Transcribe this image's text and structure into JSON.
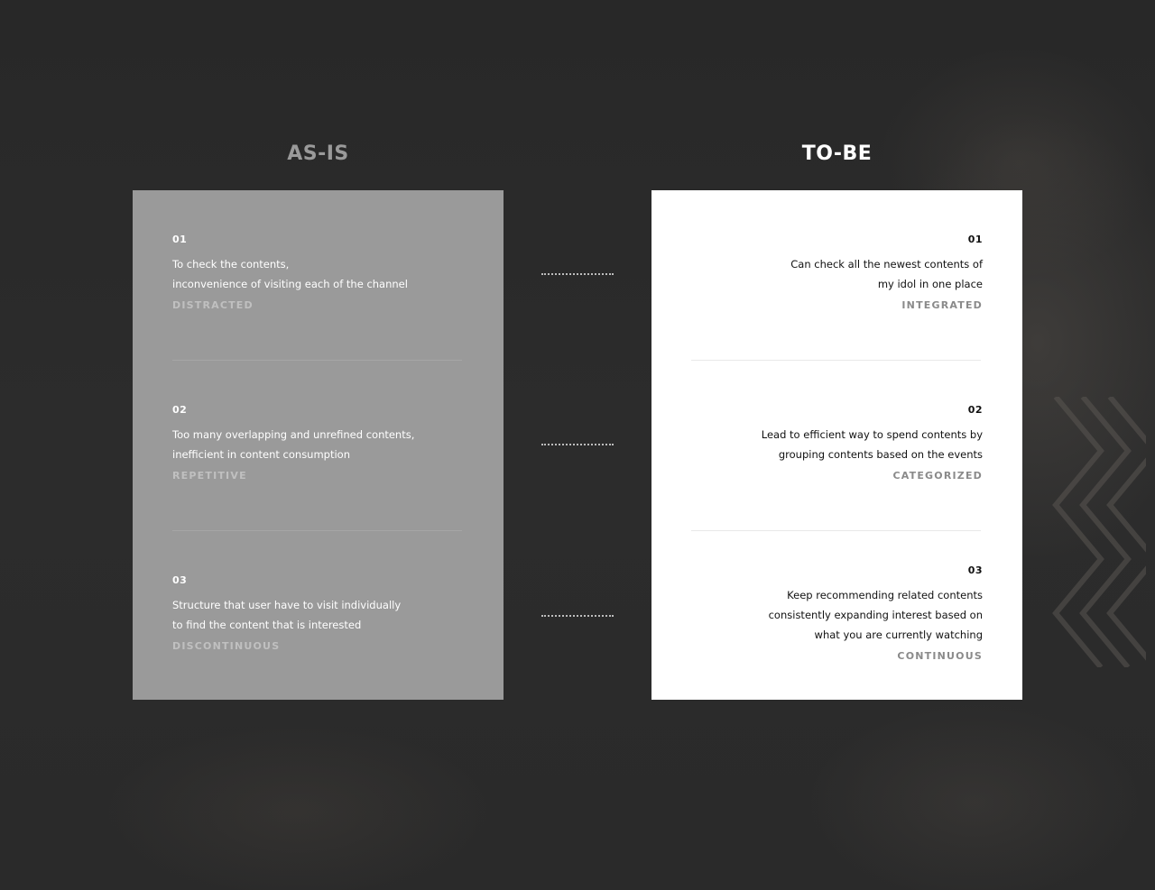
{
  "asis": {
    "heading": "AS-IS",
    "items": [
      {
        "num": "01",
        "desc": "To check the contents,\ninconvenience of visiting each of the channel",
        "tag": "DISTRACTED"
      },
      {
        "num": "02",
        "desc": "Too many overlapping and unrefined contents,\ninefficient in content consumption",
        "tag": "REPETITIVE"
      },
      {
        "num": "03",
        "desc": "Structure that user have to visit individually\nto find the content that is interested",
        "tag": "DISCONTINUOUS"
      }
    ]
  },
  "tobe": {
    "heading": "TO-BE",
    "items": [
      {
        "num": "01",
        "desc": "Can check all the newest contents of\nmy idol in one place",
        "tag": "INTEGRATED"
      },
      {
        "num": "02",
        "desc": "Lead to efficient way to spend contents by\ngrouping contents based on the events",
        "tag": "CATEGORIZED"
      },
      {
        "num": "03",
        "desc": "Keep recommending related contents\nconsistently expanding interest based on\nwhat you are currently watching",
        "tag": "CONTINUOUS"
      }
    ]
  },
  "colors": {
    "background": "#2b2b2b",
    "asis_card": "#9a9a9a",
    "tobe_card": "#ffffff",
    "asis_heading": "#9a9a9a",
    "tobe_heading": "#ffffff",
    "tag_asis": "#c0c0c0",
    "tag_tobe": "#8a8a8a"
  }
}
